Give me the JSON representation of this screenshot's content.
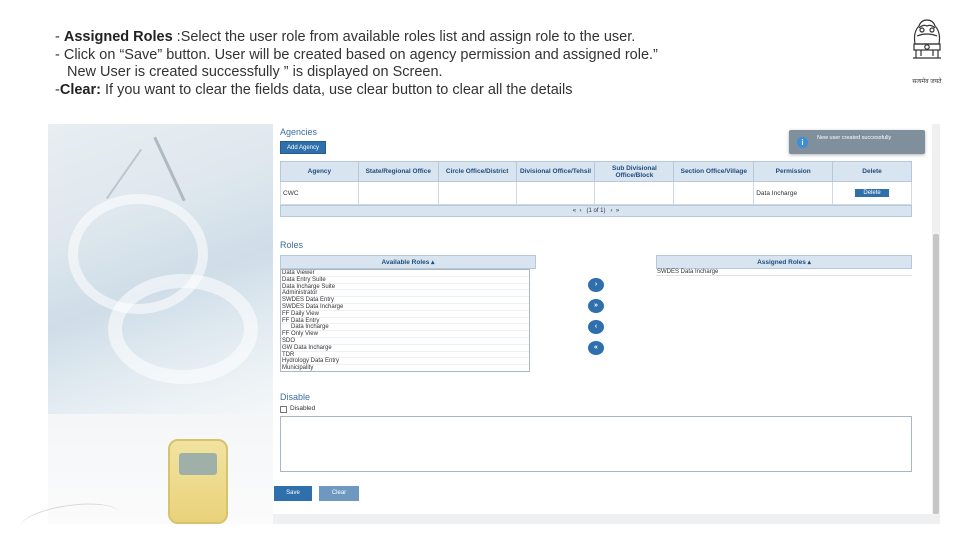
{
  "instructions": {
    "line1_prefix": "- ",
    "line1_bold": "Assigned Roles",
    "line1_rest": " :Select the user role  from available roles list and assign role to the user.",
    "line2": "- Click on “Save” button. User will be created based on agency permission and assigned role.”",
    "line3": "New User is created successfully ” is displayed on Screen.",
    "line4_prefix": "-",
    "line4_bold": "Clear:",
    "line4_rest": " If you want to clear the fields data, use clear button to clear all the details"
  },
  "emblem": {
    "motto": "सत्यमेव जयते",
    "icon": "state-emblem-icon"
  },
  "toast": {
    "message": "New user created successfully",
    "icon": "info-icon"
  },
  "agencies": {
    "title": "Agencies",
    "add_button": "Add Agency",
    "columns": [
      "Agency",
      "State/Regional Office",
      "Circle Office/District",
      "Divisional Office/Tehsil",
      "Sub Divisional Office/Block",
      "Section Office/Village",
      "Permission",
      "Delete"
    ],
    "rows": [
      {
        "agency": "CWC",
        "state": "",
        "circle": "",
        "divisional": "",
        "sub_divisional": "",
        "section": "",
        "permission": "Data Incharge",
        "delete": "Delete"
      }
    ],
    "pager": "(1 of 1)"
  },
  "roles": {
    "title": "Roles",
    "available_header": "Available Roles ▴",
    "assigned_header": "Assigned Roles ▴",
    "available": [
      "Data Viewer",
      "Data Entry Suite",
      "Data Incharge Suite",
      "Administrator",
      "SWDES Data Entry",
      "SWDES Data Incharge",
      "FF Daily View",
      "FF Data Entry",
      "Data Incharge",
      "FF Only View",
      "SDO",
      "GW Data Incharge",
      "TDR",
      "Hydrology Data Entry",
      "Municipality"
    ],
    "assigned": [
      "SWDES Data Incharge"
    ],
    "move_buttons": [
      "›",
      "»",
      "‹",
      "«"
    ]
  },
  "disable": {
    "title": "Disable",
    "checkbox_label": "Disabled"
  },
  "actions": {
    "save": "Save",
    "clear": "Clear"
  }
}
